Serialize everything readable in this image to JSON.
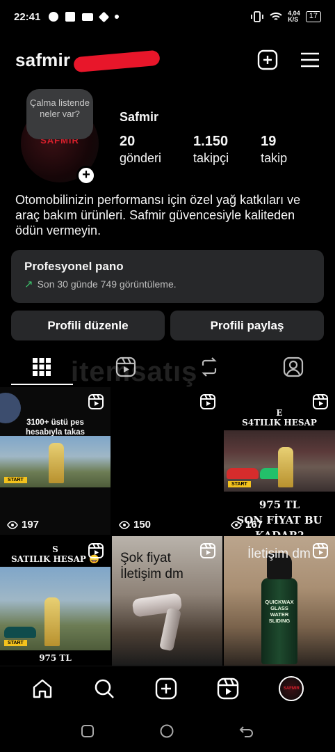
{
  "status_bar": {
    "time": "22:41",
    "net_speed": "4,04\nK/S",
    "battery": "17"
  },
  "header": {
    "username": "safmir"
  },
  "profile": {
    "note": "Çalma listende neler var?",
    "avatar_text": "SAFMIR",
    "display_name": "Safmir",
    "stats": [
      {
        "value": "20",
        "label": "gönderi"
      },
      {
        "value": "1.150",
        "label": "takipçi"
      },
      {
        "value": "19",
        "label": "takip"
      }
    ],
    "bio": "Otomobilinizin performansı için özel yağ katkıları ve araç bakım ürünleri. Safmir güvencesiyle kaliteden ödün vermeyin."
  },
  "pro_panel": {
    "title": "Profesyonel pano",
    "subtitle": "Son 30 günde 749 görüntüleme."
  },
  "buttons": {
    "edit": "Profili düzenle",
    "share": "Profili paylaş"
  },
  "watermark": "itemsatış",
  "posts": [
    {
      "caption": "3100+ üstü pes hesabıyla takas",
      "views": "197"
    },
    {
      "caption": "",
      "views": "150"
    },
    {
      "caption_top": "E\nS4TILIK HESAP",
      "caption_bottom": "975 TL\nSON FİYAT BU KADAR?",
      "views": "167"
    },
    {
      "caption_top": "S\nSATILIK HESAP 😄",
      "caption_bottom": "975 TL"
    },
    {
      "caption": "Şok fiyat\nİletişim dm"
    },
    {
      "caption": "İletişim dm",
      "product": "QUICKWAX GLASS WATER SLIDING"
    }
  ],
  "colors": {
    "background": "#000000",
    "panel": "#27282a",
    "accent_green": "#3cc26b",
    "redaction": "#e8162a"
  }
}
